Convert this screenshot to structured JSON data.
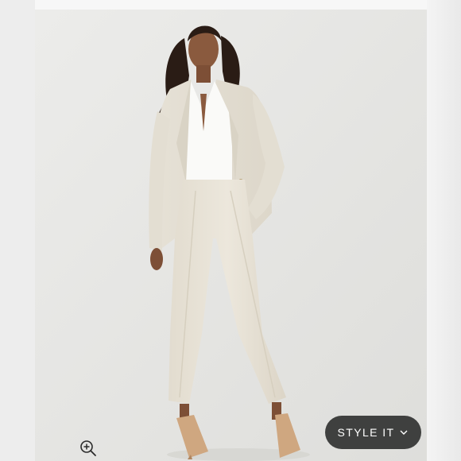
{
  "product_image": {
    "alt": "",
    "zoom_icon": "zoom-in-icon"
  },
  "style_it_button": {
    "label": "STYLE IT",
    "icon": "chevron-down-icon"
  },
  "colors": {
    "button_bg": "#3f403f",
    "button_text": "#ffffff",
    "photo_background": "#e6e6e4"
  }
}
